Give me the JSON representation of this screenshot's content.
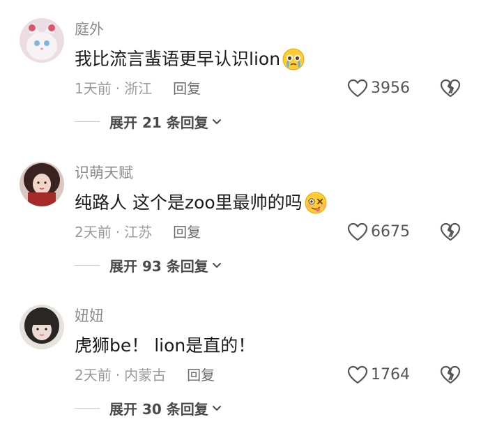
{
  "comments": [
    {
      "username": "庭外",
      "text": "我比流言蜚语更早认识lion",
      "emoji": "crying-face-emoji",
      "time": "1天前",
      "dot": "·",
      "location": "浙江",
      "reply_label": "回复",
      "likes": "3956",
      "expand_label": "展开 21 条回复"
    },
    {
      "username": "识萌天赋",
      "text": "纯路人 这个是zoo里最帅的吗",
      "emoji": "woozy-face-emoji",
      "time": "2天前",
      "dot": "·",
      "location": "江苏",
      "reply_label": "回复",
      "likes": "6675",
      "expand_label": "展开 93 条回复"
    },
    {
      "username": "妞妞",
      "text": "虎狮be！ lion是直的！",
      "emoji": "",
      "time": "2天前",
      "dot": "·",
      "location": "内蒙古",
      "reply_label": "回复",
      "likes": "1764",
      "expand_label": "展开 30 条回复"
    }
  ],
  "colors": {
    "meta_gray": "#9a9a9a",
    "username_gray": "#8a8a8a",
    "text": "#1a1a1a"
  }
}
